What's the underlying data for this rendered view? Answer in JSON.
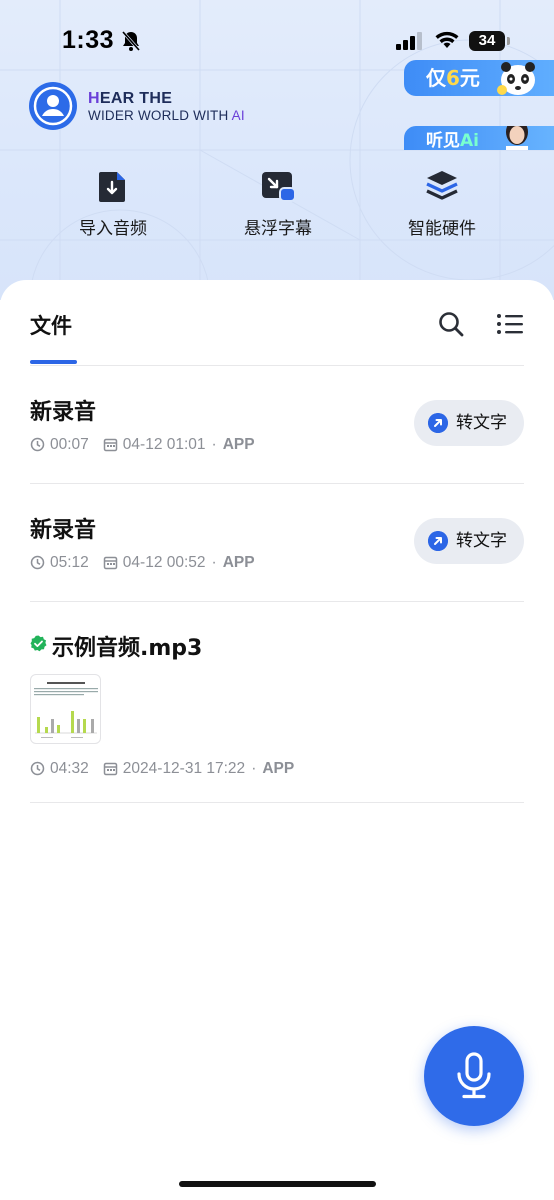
{
  "status_bar": {
    "time": "1:33",
    "battery": "34"
  },
  "brand": {
    "line1_initial": "H",
    "line1_rest": "EAR THE",
    "line2_main": "WIDER WORLD WITH ",
    "line2_ai": "AI"
  },
  "promos": {
    "promo1_text": "仅",
    "promo1_num": "6",
    "promo1_unit": "元",
    "promo2_text": "听见",
    "promo2_ai": "Ai"
  },
  "quick_actions": [
    {
      "label": "导入音频",
      "icon": "import-audio-icon"
    },
    {
      "label": "悬浮字幕",
      "icon": "floating-subtitle-icon"
    },
    {
      "label": "智能硬件",
      "icon": "smart-hardware-icon"
    }
  ],
  "files": {
    "tab_label": "文件",
    "convert_label": "转文字",
    "items": [
      {
        "title": "新录音",
        "duration": "00:07",
        "date": "04-12 01:01",
        "source": "APP"
      },
      {
        "title": "新录音",
        "duration": "05:12",
        "date": "04-12 00:52",
        "source": "APP"
      },
      {
        "title": "示例音频.mp3",
        "duration": "04:32",
        "date": "2024-12-31 17:22",
        "source": "APP"
      }
    ],
    "separator": "·"
  },
  "colors": {
    "accent": "#2c66e6",
    "fab": "#2f6be9",
    "hero_bg": "#dbe7fb",
    "check": "#22b35a"
  }
}
